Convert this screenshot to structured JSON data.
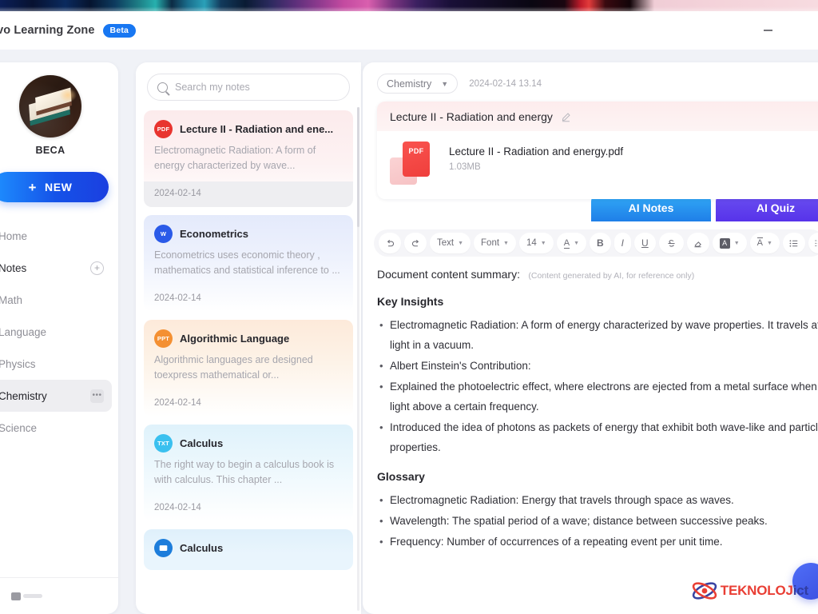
{
  "window": {
    "app_title": "enovo Learning Zone",
    "badge": "Beta",
    "minimize_label": "minimize"
  },
  "sidebar": {
    "profile_name": "BECA",
    "new_button": "NEW",
    "new_button_icon": "plus-icon",
    "items": [
      {
        "label": "Home",
        "state": "normal",
        "icon": ""
      },
      {
        "label": "Notes",
        "state": "dark",
        "icon": "plus-circle-icon"
      },
      {
        "label": "Math",
        "state": "normal",
        "icon": ""
      },
      {
        "label": "Language",
        "state": "normal",
        "icon": ""
      },
      {
        "label": "Physics",
        "state": "normal",
        "icon": ""
      },
      {
        "label": "Chemistry",
        "state": "active",
        "icon": "more-dots-icon"
      },
      {
        "label": "Science",
        "state": "normal",
        "icon": ""
      }
    ]
  },
  "notes": {
    "search_placeholder": "Search my notes",
    "search_value": "",
    "cards": [
      {
        "badge": "PDF",
        "badge_color": "#e8342f",
        "title": "Lecture II - Radiation and ene...",
        "snippet": "Electromagnetic Radiation: A form of energy characterized by wave...",
        "date": "2024-02-14",
        "theme": "selected"
      },
      {
        "badge": "W",
        "badge_color": "#2a5ae8",
        "title": "Econometrics",
        "snippet": "Econometrics uses economic theory , mathematics  and statistical inference to ...",
        "date": "2024-02-14",
        "theme": "blue"
      },
      {
        "badge": "PPT",
        "badge_color": "#f49033",
        "title": "Algorithmic Language",
        "snippet": "Algorithmic languages are designed toexpress mathematical or...",
        "date": "2024-02-14",
        "theme": "orange"
      },
      {
        "badge": "TXT",
        "badge_color": "#3ac0ef",
        "title": "Calculus",
        "snippet": "The right way to begin a calculus book is with calculus. This chapter ...",
        "date": "2024-02-14",
        "theme": "cyan"
      },
      {
        "badge": "IMG",
        "badge_color": "#1d7ddb",
        "title": "Calculus",
        "snippet": "",
        "date": "",
        "theme": "cyan2"
      }
    ]
  },
  "main": {
    "category": "Chemistry",
    "category_caret": "▼",
    "timestamp": "2024-02-14 13.14",
    "doc_title": "Lecture II - Radiation and energy",
    "edit_icon": "pencil-icon",
    "file_badge": "PDF",
    "file_name": "Lecture II - Radiation and energy.pdf",
    "file_size": "1.03MB",
    "tabs": [
      {
        "label": "AI Notes",
        "color": "#2186ea",
        "active": true
      },
      {
        "label": "AI Quiz",
        "color": "#5b37ea",
        "active": false
      }
    ],
    "toolbar": [
      {
        "name": "undo-icon",
        "label": "",
        "type": "icon"
      },
      {
        "name": "redo-icon",
        "label": "",
        "type": "icon"
      },
      {
        "name": "text-style-dropdown",
        "label": "Text",
        "type": "menu"
      },
      {
        "name": "font-dropdown",
        "label": "Font",
        "type": "menu"
      },
      {
        "name": "font-size-dropdown",
        "label": "14",
        "type": "menu"
      },
      {
        "name": "text-color-dropdown",
        "label": "A",
        "type": "menu"
      },
      {
        "name": "bold-icon",
        "label": "B",
        "type": "icon"
      },
      {
        "name": "italic-icon",
        "label": "I",
        "type": "icon"
      },
      {
        "name": "underline-icon",
        "label": "U",
        "type": "icon"
      },
      {
        "name": "strikethrough-icon",
        "label": "S",
        "type": "icon"
      },
      {
        "name": "eraser-icon",
        "label": "",
        "type": "icon"
      },
      {
        "name": "highlight-dropdown",
        "label": "A",
        "type": "menu"
      },
      {
        "name": "clear-format-dropdown",
        "label": "A",
        "type": "menu"
      },
      {
        "name": "bullet-list-icon",
        "label": "",
        "type": "icon"
      },
      {
        "name": "ordered-list-icon",
        "label": "",
        "type": "icon"
      }
    ],
    "summary_label": "Document content summary:",
    "summary_note": "(Content generated by AI, for reference only)",
    "sections": [
      {
        "title": "Key Insights",
        "bullets": [
          "Electromagnetic Radiation: A form of energy characterized by wave properties. It travels at the speed of light in a vacuum.",
          "Albert Einstein's Contribution:",
          "Explained the photoelectric effect, where electrons are ejected from a metal surface when exposed to light above a certain frequency.",
          "Introduced the idea of photons as packets of energy that exhibit both wave-like and particle-like properties."
        ]
      },
      {
        "title": "Glossary",
        "bullets": [
          "Electromagnetic Radiation: Energy that travels through space as waves.",
          "Wavelength: The spatial period of a wave; distance between successive peaks.",
          "Frequency: Number of occurrences of a repeating event per unit time."
        ]
      }
    ]
  },
  "watermark": {
    "text_part1": "TEKNOLOJ",
    "text_part2": "i",
    "text_part3": "ct"
  }
}
